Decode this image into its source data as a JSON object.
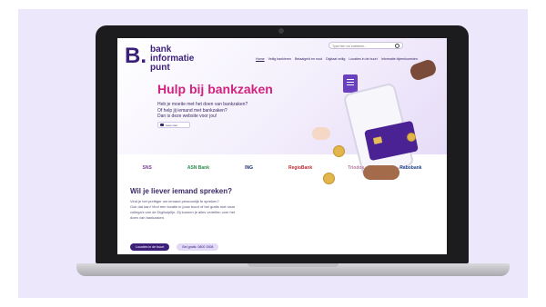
{
  "colors": {
    "background": "#ece7fa",
    "brand_purple": "#3b1f7a",
    "accent_pink": "#d1237f"
  },
  "site": {
    "logo_mark": "B.",
    "logo_lines": [
      "bank",
      "informatie",
      "punt"
    ],
    "search_placeholder": "Type hier uw zoekterm..."
  },
  "nav": {
    "items": [
      "Home",
      "Veilig bankieren",
      "Betaalgeld en rood",
      "Digitaal veilig",
      "Locaties in de buurt",
      "Informatie bijeenkomsten"
    ]
  },
  "hero": {
    "title": "Hulp bij bankzaken",
    "lines": [
      "Heb je moeite met het doen van bankzaken?",
      "Of help jij iemand met bankzaken?",
      "Dan is deze website voor jou!"
    ],
    "audio_label": "Lees voor"
  },
  "banks": [
    "SNS",
    "ASN Bank",
    "ING",
    "RegioBank",
    "Triodos",
    "Rabobank"
  ],
  "contact": {
    "title": "Wil je liever iemand spreken?",
    "lines": [
      "Vind je het prettiger om iemand persoonlijk te spreken?",
      "Ook dat kan! Vind een locatie in jouw buurt of bel gratis met onze",
      "collega's van de Digihulplijn. Zij kunnen je alles vertellen over het",
      "doen van bankzaken."
    ],
    "primary_button": "Locaties in de buurt",
    "secondary_button": "Bel gratis: 0800 1508"
  }
}
